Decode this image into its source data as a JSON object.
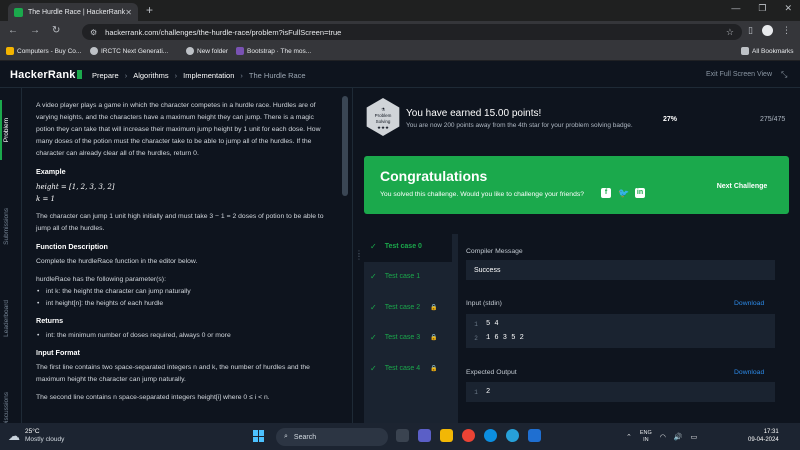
{
  "browser": {
    "tab_title": "The Hurdle Race | HackerRank",
    "url": "hackerrank.com/challenges/the-hurdle-race/problem?isFullScreen=true",
    "bookmarks": [
      "Computers - Buy Co...",
      "IRCTC Next Generati...",
      "New folder",
      "Bootstrap · The mos...",
      "All Bookmarks"
    ]
  },
  "header": {
    "logo": "HackerRank",
    "breadcrumbs": [
      "Prepare",
      "Algorithms",
      "Implementation",
      "The Hurdle Race"
    ],
    "exit_fullscreen": "Exit Full Screen View"
  },
  "side_tabs": [
    "Problem",
    "Submissions",
    "Leaderboard",
    "Discussions"
  ],
  "problem": {
    "intro": "A video player plays a game in which the character competes in a hurdle race. Hurdles are of varying heights, and the characters have a maximum height they can jump. There is a magic potion they can take that will increase their maximum jump height by 1 unit for each dose. How many doses of the potion must the character take to be able to jump all of the hurdles. If the character can already clear all of the hurdles, return 0.",
    "example_heading": "Example",
    "example_height": "height = [1, 2, 3, 3, 2]",
    "example_k": "k = 1",
    "example_text": "The character can jump 1 unit high initially and must take 3 − 1 = 2 doses of potion to be able to jump all of the hurdles.",
    "function_heading": "Function Description",
    "function_text": "Complete the hurdleRace function in the editor below.",
    "params_text": "hurdleRace has the following parameter(s):",
    "params": [
      "int k: the height the character can jump naturally",
      "int height[n]: the heights of each hurdle"
    ],
    "returns_heading": "Returns",
    "returns": [
      "int: the minimum number of doses required, always 0 or more"
    ],
    "input_heading": "Input Format",
    "input_text": "The first line contains two space-separated integers n and k, the number of hurdles and the maximum height the character can jump naturally.",
    "input_text2": "The second line contains n space-separated integers height[i] where 0 ≤ i < n."
  },
  "achievement": {
    "badge_label": "Problem Solving",
    "earned": "You have earned 15.00 points!",
    "away": "You are now 200 points away from the 4th star for your problem solving badge.",
    "percent": "27%",
    "score": "275/475"
  },
  "congrats": {
    "title": "Congratulations",
    "subtitle": "You solved this challenge. Would you like to challenge your friends?",
    "next_button": "Next Challenge"
  },
  "test_cases": [
    {
      "label": "Test case 0",
      "locked": false
    },
    {
      "label": "Test case 1",
      "locked": false
    },
    {
      "label": "Test case 2",
      "locked": true
    },
    {
      "label": "Test case 3",
      "locked": true
    },
    {
      "label": "Test case 4",
      "locked": true
    }
  ],
  "details": {
    "compiler_label": "Compiler Message",
    "compiler_message": "Success",
    "input_label": "Input (stdin)",
    "download": "Download",
    "input_lines": [
      "5 4",
      "1 6 3 5 2"
    ],
    "expected_label": "Expected Output",
    "expected_lines": [
      "2"
    ]
  },
  "taskbar": {
    "temp": "25°C",
    "weather": "Mostly cloudy",
    "search": "Search",
    "lang1": "ENG",
    "lang2": "IN",
    "time": "17:31",
    "date": "09-04-2024"
  },
  "colors": {
    "accent": "#1ba94c",
    "link": "#2c89e6",
    "bg": "#0e141e"
  }
}
